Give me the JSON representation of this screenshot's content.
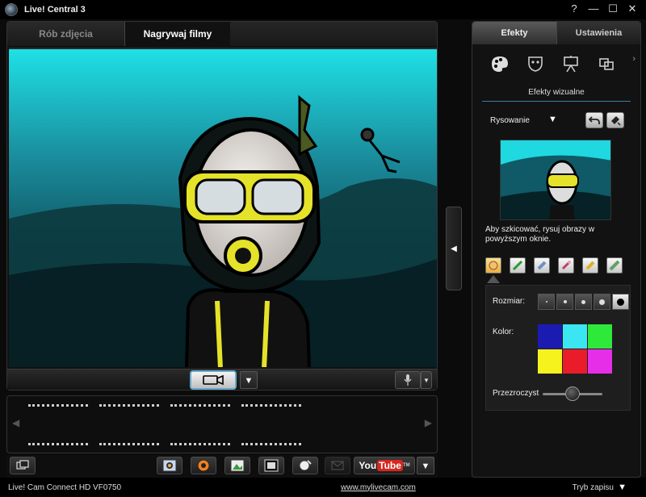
{
  "window": {
    "title": "Live! Central 3"
  },
  "window_controls": {
    "help": "?",
    "minimize": "—",
    "maximize": "☐",
    "close": "✕"
  },
  "main_tabs": [
    {
      "label": "Rób zdjęcia",
      "active": false
    },
    {
      "label": "Nagrywaj filmy",
      "active": true
    }
  ],
  "video_toolbar": {
    "record_icon": "video-camera-icon",
    "dropdown": "▼",
    "mic_dropdown": "▼"
  },
  "strip": {
    "prev": "◀",
    "next": "▶"
  },
  "bottom_tools": [
    {
      "icon": "folder-icon"
    },
    {
      "icon": "webcam-capture-icon"
    },
    {
      "icon": "cd-burn-icon"
    },
    {
      "icon": "photo-edit-icon"
    },
    {
      "icon": "film-strip-icon"
    },
    {
      "icon": "video-effect-icon"
    },
    {
      "icon": "email-icon"
    }
  ],
  "youtube": {
    "you": "You",
    "tube": "Tube",
    "tm": "TM",
    "dropdown": "▼"
  },
  "status": {
    "device": "Live! Cam Connect HD VF0750",
    "link": "www.mylivecam.com",
    "mode": "Tryb zapisu",
    "mode_dropdown": "▼"
  },
  "side_handle": "◀",
  "right_tabs": [
    {
      "label": "Efekty",
      "active": true
    },
    {
      "label": "Ustawienia",
      "active": false
    }
  ],
  "effect_category_icons": [
    "palette-icon",
    "mask-icon",
    "easel-icon",
    "overlay-icon"
  ],
  "more_arrow": "›",
  "section_title": "Efekty wizualne",
  "mode": {
    "label": "Rysowanie",
    "dropdown": "▼"
  },
  "hint": "Aby szkicować, rysuj obrazy w powyższym oknie.",
  "brushes": [
    "face-brush-icon",
    "green-pen-icon",
    "eraser-icon",
    "stamp-icon",
    "yellow-brush-icon",
    "ruler-icon"
  ],
  "options": {
    "size_label": "Rozmiar:",
    "color_label": "Kolor:",
    "opacity_label": "Przezroczyst",
    "sizes": [
      1,
      2,
      3,
      4,
      5
    ],
    "selected_size_index": 4,
    "colors": [
      "#1b1bb2",
      "#3ae6f2",
      "#2ee83a",
      "#f5f21e",
      "#ea1c2a",
      "#e62ee8"
    ],
    "opacity": 0.5
  }
}
